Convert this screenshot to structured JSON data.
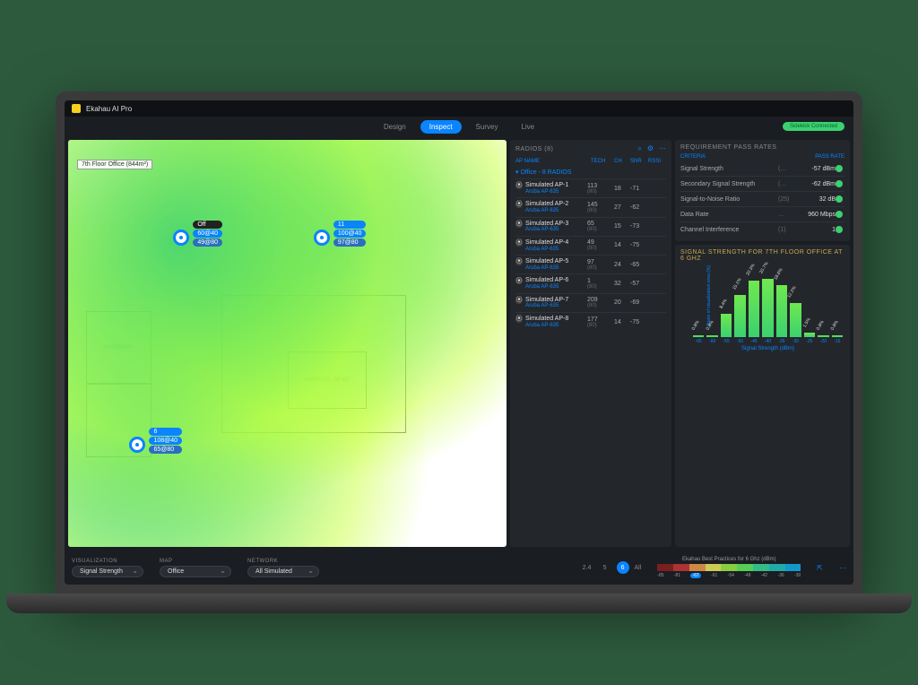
{
  "app": {
    "title": "Ekahau AI Pro",
    "connect": "Sidekick Connected"
  },
  "tabs": [
    "Design",
    "Inspect",
    "Survey",
    "Live"
  ],
  "active_tab": "Inspect",
  "map": {
    "label": "7th Floor Office (844m²)",
    "rooms": {
      "varasto": "VARASTO ~31 m2",
      "breakfast": "BVORMSH."
    }
  },
  "aps": [
    {
      "id": "ap1",
      "top": "22%",
      "left": "24%",
      "tags": [
        {
          "t": "Off",
          "cls": "off"
        },
        {
          "t": "60@40"
        },
        {
          "t": "49@80",
          "cls": "dim"
        }
      ]
    },
    {
      "id": "ap2",
      "top": "22%",
      "left": "56%",
      "tags": [
        {
          "t": "11"
        },
        {
          "t": "100@40"
        },
        {
          "t": "97@80",
          "cls": "dim"
        }
      ]
    },
    {
      "id": "ap3",
      "top": "73%",
      "left": "14%",
      "tags": [
        {
          "t": "6"
        },
        {
          "t": "108@40"
        },
        {
          "t": "65@80",
          "cls": "dim"
        }
      ]
    }
  ],
  "radios": {
    "title": "RADIOS (8)",
    "columns": [
      "AP NAME",
      "TECH",
      "CH",
      "SNR",
      "RSSI"
    ],
    "group": "▾ Office - 8 RADIOS",
    "rows": [
      {
        "name": "Simulated AP-1",
        "model": "Aruba AP-635",
        "ch": "113",
        "chw": "(80)",
        "snr": "18",
        "rssi": "-71"
      },
      {
        "name": "Simulated AP-2",
        "model": "Aruba AP-635",
        "ch": "145",
        "chw": "(80)",
        "snr": "27",
        "rssi": "-62"
      },
      {
        "name": "Simulated AP-3",
        "model": "Aruba AP-635",
        "ch": "65",
        "chw": "(80)",
        "snr": "15",
        "rssi": "-73"
      },
      {
        "name": "Simulated AP-4",
        "model": "Aruba AP-635",
        "ch": "49",
        "chw": "(80)",
        "snr": "14",
        "rssi": "-75"
      },
      {
        "name": "Simulated AP-5",
        "model": "Aruba AP-635",
        "ch": "97",
        "chw": "(80)",
        "snr": "24",
        "rssi": "-65"
      },
      {
        "name": "Simulated AP-6",
        "model": "Aruba AP-635",
        "ch": "1",
        "chw": "(80)",
        "snr": "32",
        "rssi": "-57"
      },
      {
        "name": "Simulated AP-7",
        "model": "Aruba AP-635",
        "ch": "209",
        "chw": "(80)",
        "snr": "20",
        "rssi": "-69"
      },
      {
        "name": "Simulated AP-8",
        "model": "Aruba AP-635",
        "ch": "177",
        "chw": "(80)",
        "snr": "14",
        "rssi": "-75"
      }
    ]
  },
  "requirements": {
    "title": "REQUIREMENT PASS RATES",
    "cols": [
      "CRITERIA",
      "PASS RATE"
    ],
    "rows": [
      {
        "name": "Signal Strength",
        "hint": "(…",
        "val": "-57 dBm"
      },
      {
        "name": "Secondary Signal Strength",
        "hint": "(…",
        "val": "-62 dBm"
      },
      {
        "name": "Signal-to-Noise Ratio",
        "hint": "(25)",
        "val": "32 dB"
      },
      {
        "name": "Data Rate",
        "hint": "…",
        "val": "960 Mbps"
      },
      {
        "name": "Channel Interference",
        "hint": "(1)",
        "val": "1"
      }
    ]
  },
  "chart_data": {
    "type": "bar",
    "title": "SIGNAL STRENGTH FOR 7TH FLOOR OFFICE AT 6 GHZ",
    "xlabel": "Signal Strength (dBm)",
    "ylabel": "Share of visualization area (%)",
    "categories": [
      "-65",
      "-60",
      "-55",
      "-50",
      "-45",
      "-40",
      "-35",
      "-30",
      "-25",
      "-20",
      "-15"
    ],
    "values": [
      0.8,
      0.8,
      8.4,
      15.1,
      20.3,
      20.7,
      18.6,
      12.2,
      1.5,
      0.8,
      0.8
    ],
    "ylim": [
      0,
      25
    ]
  },
  "footer": {
    "viz": {
      "label": "VISUALIZATION",
      "value": "Signal Strength"
    },
    "map": {
      "label": "MAP",
      "value": "Office"
    },
    "net": {
      "label": "NETWORK",
      "value": "All Simulated"
    },
    "bands": [
      "2.4",
      "5",
      "6",
      "All"
    ],
    "active_band": "6",
    "legend_title": "Ekahau Best Practices for 6 Ghz (dBm)",
    "legend_ticks": [
      "-85",
      "-81",
      "-67",
      "-61",
      "-54",
      "-48",
      "-42",
      "-36",
      "-30"
    ],
    "legend_hl": "-67"
  }
}
